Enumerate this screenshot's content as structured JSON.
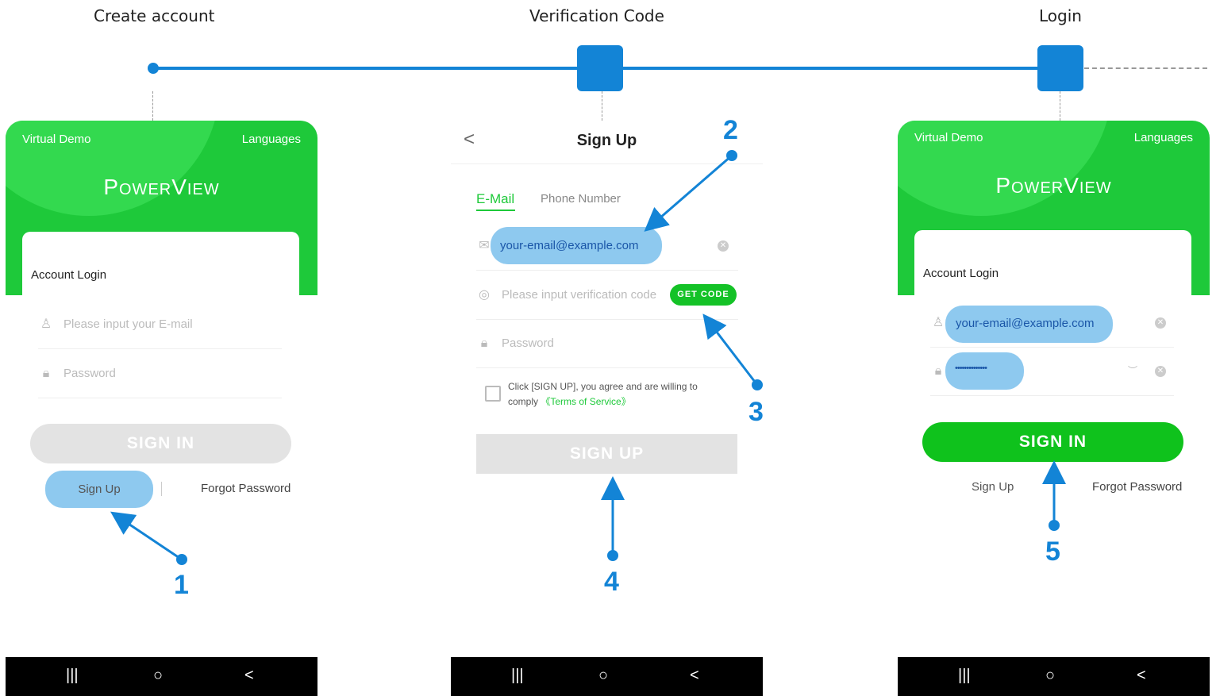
{
  "steps": {
    "create": "Create account",
    "verify": "Verification Code",
    "login": "Login"
  },
  "login_screen": {
    "left_link": "Virtual Demo",
    "right_link": "Languages",
    "logo": "PowerView",
    "title": "Account Login",
    "email_placeholder": "Please input your E-mail",
    "password_placeholder": "Password",
    "sign_in": "SIGN IN",
    "sign_up": "Sign Up",
    "forgot": "Forgot Password"
  },
  "signup_screen": {
    "back": "<",
    "title": "Sign Up",
    "tab_email": "E-Mail",
    "tab_phone": "Phone Number",
    "email_value": "your-email@example.com",
    "code_placeholder": "Please input verification code",
    "get_code": "GET CODE",
    "password_placeholder": "Password",
    "terms_text": "Click [SIGN UP], you agree and are willing to comply",
    "terms_link": "《Terms of Service》",
    "sign_up": "SIGN UP"
  },
  "login_filled": {
    "left_link": "Virtual Demo",
    "right_link": "Languages",
    "logo": "PowerView",
    "title": "Account Login",
    "email_value": "your-email@example.com",
    "password_value": "••••••••••••••",
    "sign_in": "SIGN IN",
    "sign_up": "Sign Up",
    "forgot": "Forgot Password"
  },
  "callouts": {
    "n1": "1",
    "n2": "2",
    "n3": "3",
    "n4": "4",
    "n5": "5"
  },
  "navbar": {
    "recent": "|||",
    "home": "○",
    "back": "<"
  },
  "colors": {
    "accent_green": "#1ec93a",
    "callout_blue": "#1384d6",
    "highlight_blue": "#8ec9ef"
  }
}
